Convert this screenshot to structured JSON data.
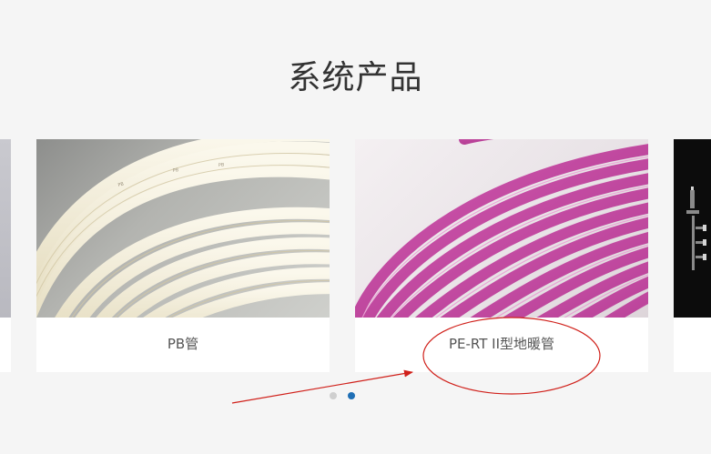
{
  "section": {
    "title": "系统产品"
  },
  "products": [
    {
      "label": "PB管"
    },
    {
      "label": "PE-RT II型地暖管"
    }
  ],
  "pagination": {
    "count": 2,
    "active_index": 2
  },
  "colors": {
    "background": "#f5f5f5",
    "card": "#ffffff",
    "title_text": "#333333",
    "label_text": "#555555",
    "dot_active": "#1f6fb5",
    "dot_inactive": "#cfcfcf",
    "annotation_red": "#d0201a",
    "pb_pipe": "#f2ecd6",
    "pert_pipe": "#c0449e"
  }
}
